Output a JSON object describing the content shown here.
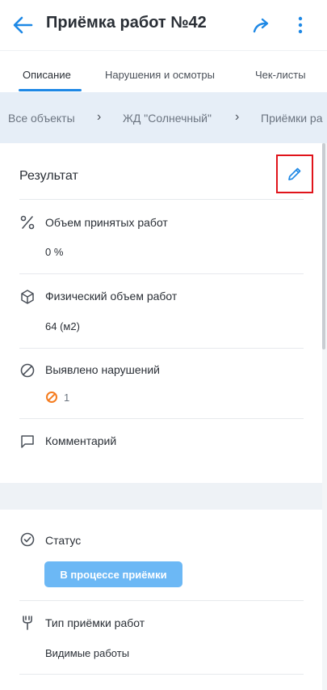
{
  "header": {
    "title": "Приёмка работ №42"
  },
  "tabs": [
    {
      "label": "Описание"
    },
    {
      "label": "Нарушения и осмотры"
    },
    {
      "label": "Чек-листы"
    }
  ],
  "breadcrumbs": [
    {
      "label": "Все объекты"
    },
    {
      "label": "ЖД \"Солнечный\""
    },
    {
      "label": "Приёмки ра"
    }
  ],
  "result": {
    "title": "Результат",
    "rows": [
      {
        "label": "Объем принятых работ",
        "value": "0 %"
      },
      {
        "label": "Физический объем работ",
        "value": "64 (м2)"
      },
      {
        "label": "Выявлено нарушений",
        "value": "1"
      },
      {
        "label": "Комментарий"
      }
    ]
  },
  "details": {
    "status_label": "Статус",
    "status_value": "В процессе приёмки",
    "type_label": "Тип приёмки работ",
    "type_value": "Видимые работы"
  },
  "colors": {
    "accent": "#1e88e5",
    "status_badge": "#6cb8f5",
    "violation": "#f57c1f",
    "highlight_box": "#e0141b"
  }
}
